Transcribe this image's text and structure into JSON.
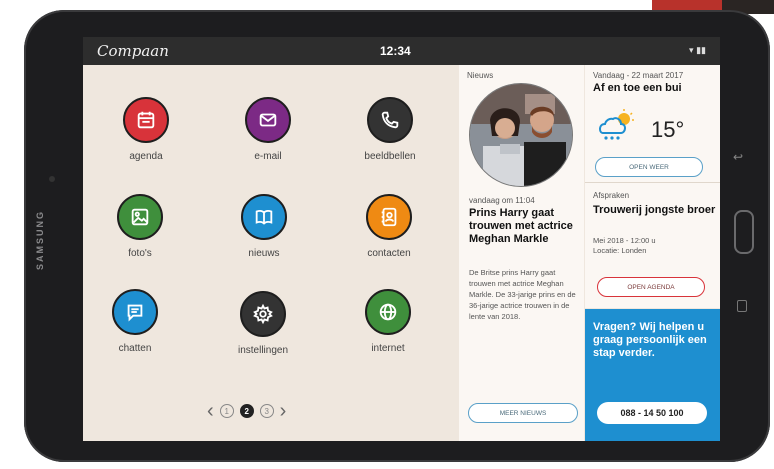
{
  "app": {
    "title": "Compaan",
    "clock": "12:34"
  },
  "apps": [
    {
      "label": "agenda",
      "color": "#d8333a"
    },
    {
      "label": "e-mail",
      "color": "#7c2a85"
    },
    {
      "label": "beeldbellen",
      "color": "#333333"
    },
    {
      "label": "foto's",
      "color": "#3f8f3c"
    },
    {
      "label": "nieuws",
      "color": "#1e8fd0"
    },
    {
      "label": "contacten",
      "color": "#ef8a13"
    },
    {
      "label": "chatten",
      "color": "#1e8fd0"
    },
    {
      "label": "instellingen",
      "color": "#333333"
    },
    {
      "label": "internet",
      "color": "#3f8f3c"
    }
  ],
  "pager": {
    "pages": [
      "1",
      "2",
      "3"
    ],
    "active": "2"
  },
  "news": {
    "section_label": "Nieuws",
    "date": "vandaag om 11:04",
    "headline": "Prins Harry gaat trouwen met actrice Meghan Markle",
    "body": "De Britse prins Harry gaat trouwen met actrice Meghan Markle.  De 33-jarige prins en de 36-jarige actrice trouwen in de lente van 2018.",
    "more_button": "MEER NIEUWS"
  },
  "weather": {
    "date": "Vandaag - 22 maart 2017",
    "title": "Af en toe een bui",
    "temperature": "15°",
    "button": "OPEN WEER"
  },
  "appointments": {
    "section_label": "Afspraken",
    "title": "Trouwerij jongste broer",
    "when": "Mei 2018 - 12:00 u",
    "where": "Locatie: Londen",
    "button": "OPEN AGENDA"
  },
  "help": {
    "text": "Vragen? Wij helpen u graag persoonlijk een stap verder.",
    "phone": "088 - 14 50 100",
    "accent": "#1e8fd0"
  },
  "device": {
    "brand": "SAMSUNG"
  }
}
